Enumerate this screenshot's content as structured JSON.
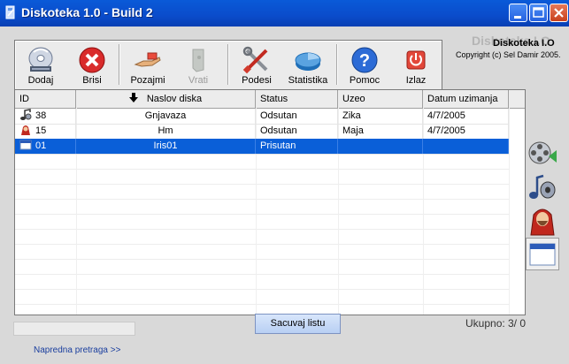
{
  "window": {
    "title": "Diskoteka 1.0 - Build 2"
  },
  "brand": {
    "ghost": "Diskoteka I.O",
    "name": "Diskoteka I.O",
    "copyright": "Copyright (c) Sel Damir 2005."
  },
  "toolbar": {
    "items": [
      {
        "label": "Dodaj",
        "icon": "cd-add-icon",
        "enabled": true
      },
      {
        "label": "Brisi",
        "icon": "delete-icon",
        "enabled": true
      },
      {
        "label": "Pozajmi",
        "icon": "lend-hand-icon",
        "enabled": true
      },
      {
        "label": "Vrati",
        "icon": "return-icon",
        "enabled": false
      },
      {
        "label": "Podesi",
        "icon": "tools-icon",
        "enabled": true
      },
      {
        "label": "Statistika",
        "icon": "pie-chart-icon",
        "enabled": true
      },
      {
        "label": "Pomoc",
        "icon": "help-icon",
        "enabled": true
      },
      {
        "label": "Izlaz",
        "icon": "power-icon",
        "enabled": true
      }
    ]
  },
  "table": {
    "columns": [
      "ID",
      "Naslov diska",
      "Status",
      "Uzeo",
      "Datum uzimanja"
    ],
    "sorted_column": "Naslov diska",
    "rows": [
      {
        "icon": "music-icon",
        "id": "38",
        "title": "Gnjavaza",
        "status": "Odsutan",
        "taken_by": "Zika",
        "date": "4/7/2005",
        "selected": false
      },
      {
        "icon": "game-icon",
        "id": "15",
        "title": "Hm",
        "status": "Odsutan",
        "taken_by": "Maja",
        "date": "4/7/2005",
        "selected": false
      },
      {
        "icon": "program-icon",
        "id": "01",
        "title": "Iris01",
        "status": "Prisutan",
        "taken_by": "",
        "date": "",
        "selected": true
      }
    ]
  },
  "side_categories": [
    {
      "icon": "film-icon"
    },
    {
      "icon": "music-icon"
    },
    {
      "icon": "game-icon"
    },
    {
      "icon": "program-icon",
      "active": true
    }
  ],
  "footer": {
    "save_label": "Sacuvaj listu",
    "total_label": "Ukupno:",
    "total_value": "3/ 0",
    "advanced_search": "Napredna pretraga >>"
  },
  "colors": {
    "title_bar": "#0a4ccb",
    "selection": "#0a5fd8",
    "close_button": "#c8401c"
  }
}
